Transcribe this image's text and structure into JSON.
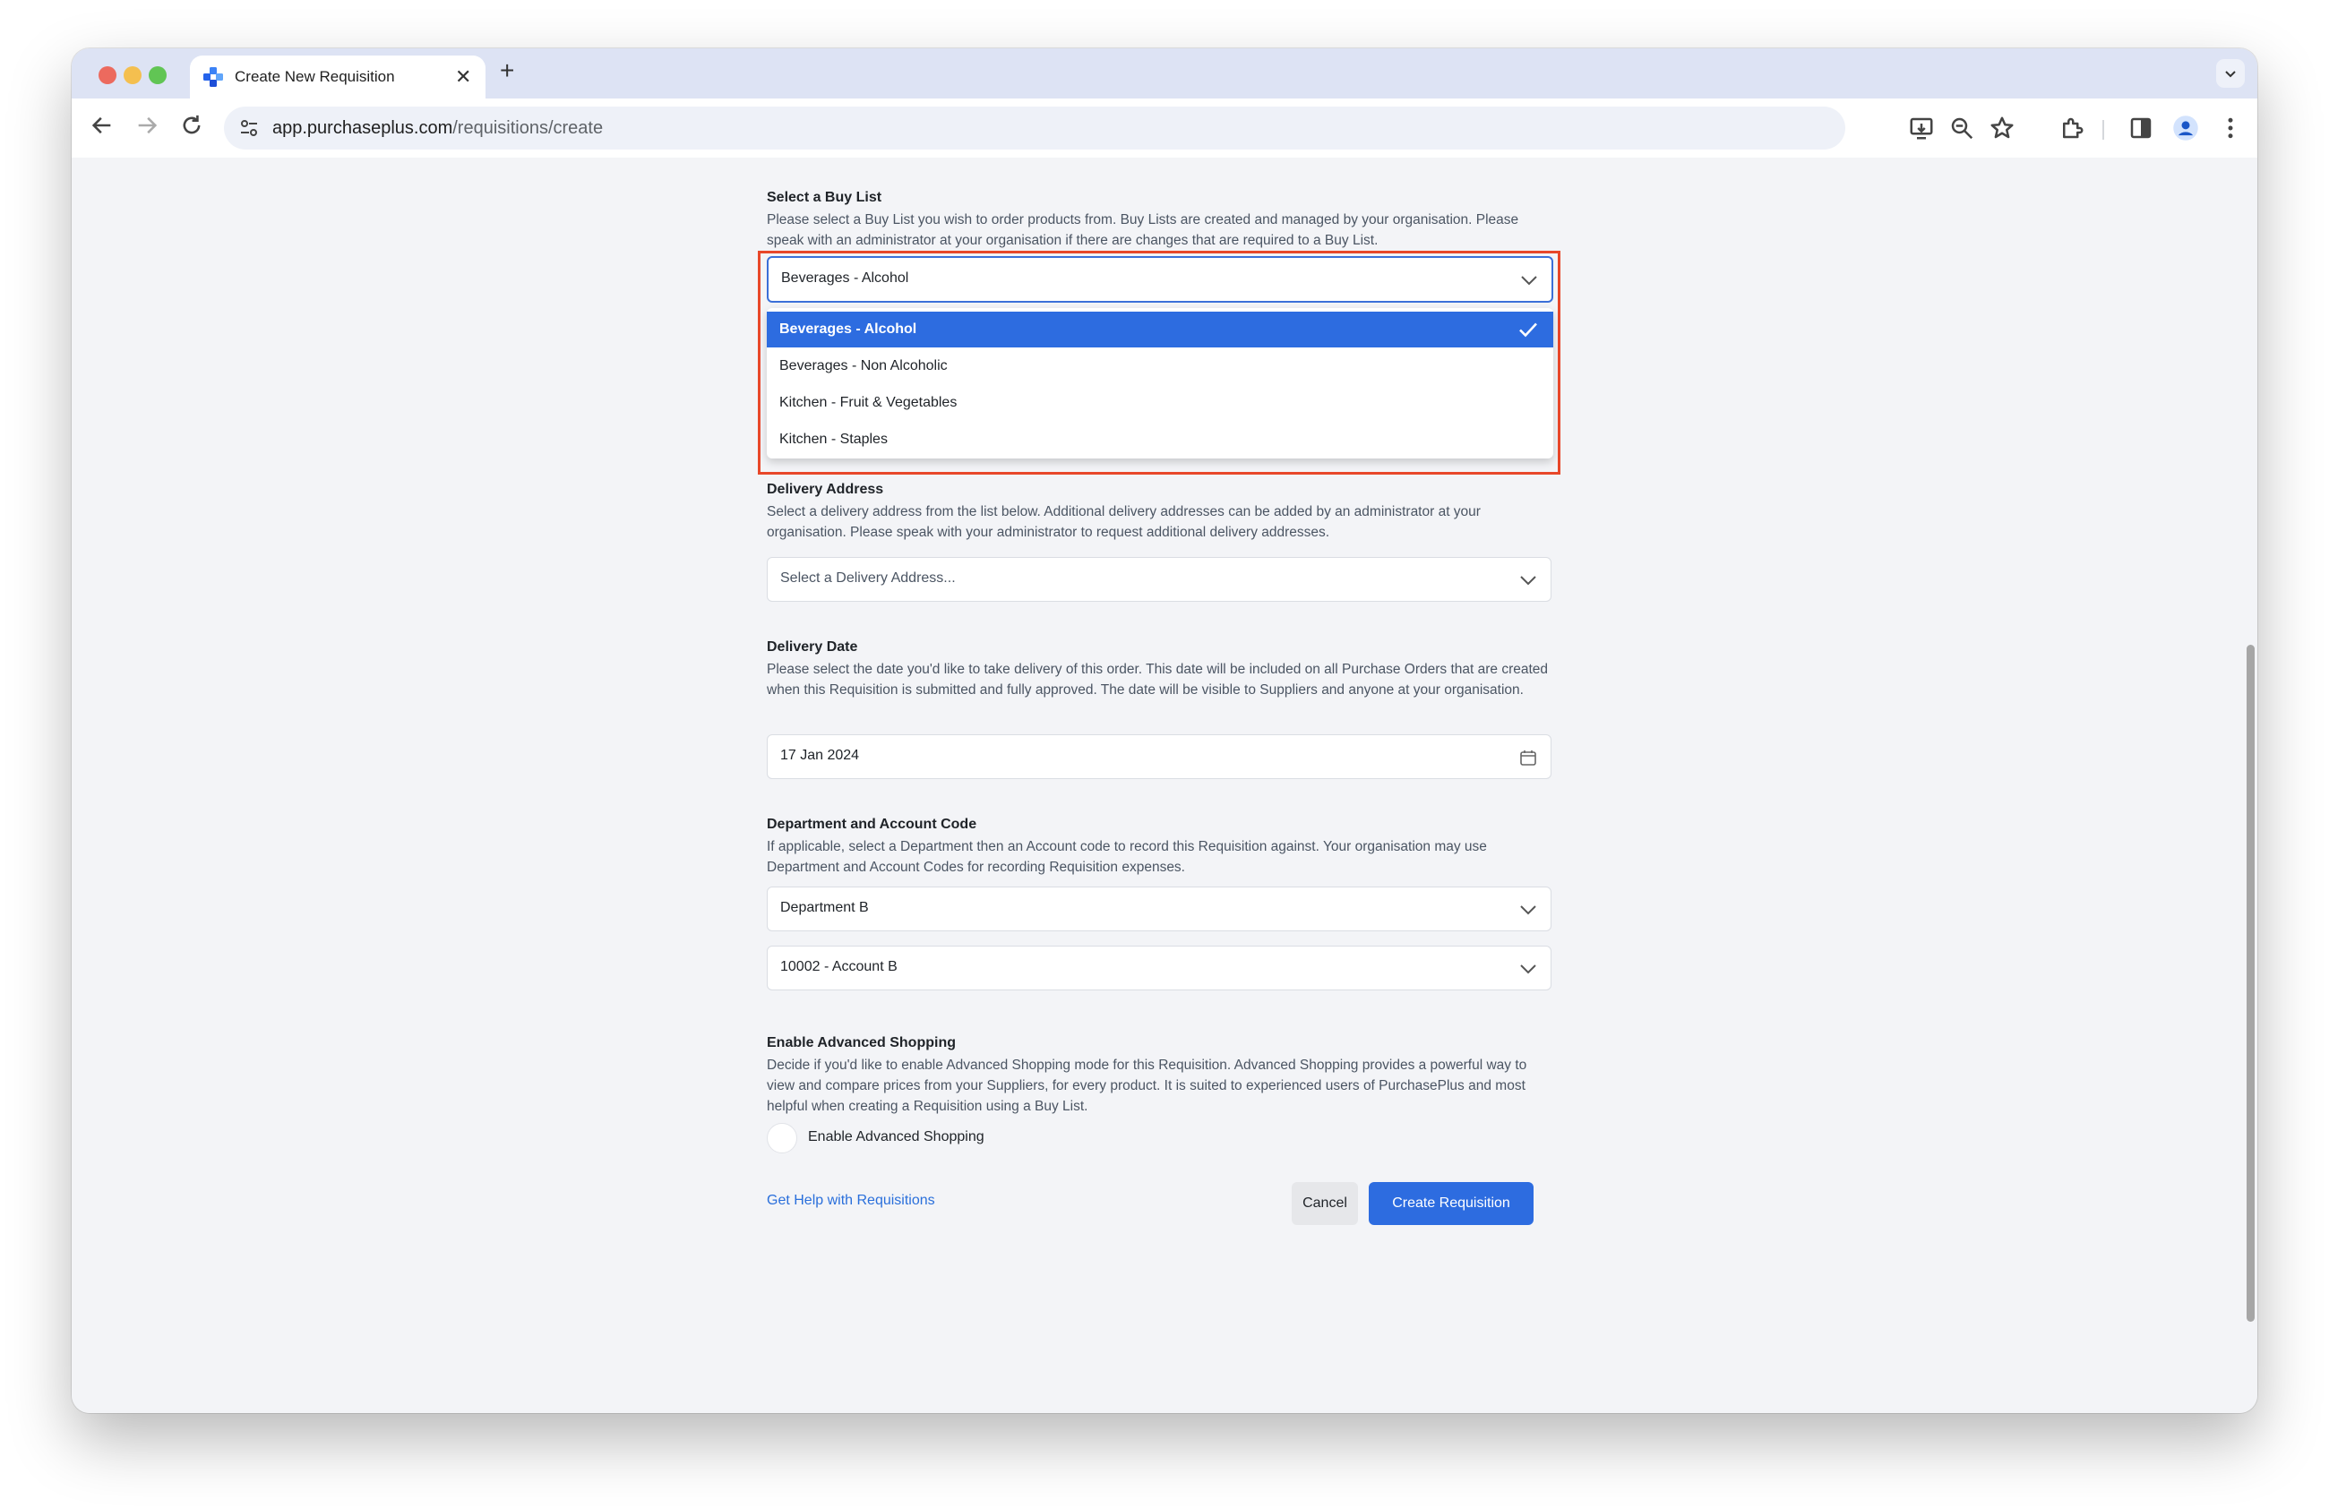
{
  "browser": {
    "tab_title": "Create New Requisition",
    "tab_close": "✕",
    "new_tab": "+",
    "url_domain": "app.purchaseplus.com",
    "url_path": "/requisitions/create"
  },
  "form": {
    "buy_list": {
      "title": "Select a Buy List",
      "description": "Please select a Buy List you wish to order products from. Buy Lists are created and managed by your organisation. Please speak with an administrator at your organisation if there are changes that are required to a Buy List.",
      "selected": "Beverages - Alcohol",
      "options": [
        "Beverages - Alcohol",
        "Beverages - Non Alcoholic",
        "Kitchen - Fruit & Vegetables",
        "Kitchen - Staples"
      ]
    },
    "delivery_address": {
      "title": "Delivery Address",
      "description": "Select a delivery address from the list below. Additional delivery addresses can be added by an administrator at your organisation. Please speak with your administrator to request additional delivery addresses.",
      "placeholder": "Select a Delivery Address..."
    },
    "delivery_date": {
      "title": "Delivery Date",
      "description": "Please select the date you'd like to take delivery of this order. This date will be included on all Purchase Orders that are created when this Requisition is submitted and fully approved. The date will be visible to Suppliers and anyone at your organisation.",
      "value": "17 Jan 2024"
    },
    "department": {
      "title": "Department and Account Code",
      "description": "If applicable, select a Department then an Account code to record this Requisition against. Your organisation may use Department and Account Codes for recording Requisition expenses.",
      "department_value": "Department B",
      "account_value": "10002 - Account B"
    },
    "advanced_shopping": {
      "title": "Enable Advanced Shopping",
      "description": "Decide if you'd like to enable Advanced Shopping mode for this Requisition. Advanced Shopping provides a powerful way to view and compare prices from your Suppliers, for every product. It is suited to experienced users of PurchasePlus and most helpful when creating a Requisition using a Buy List.",
      "toggle_label": "Enable Advanced Shopping"
    },
    "footer": {
      "help_link": "Get Help with Requisitions",
      "cancel_label": "Cancel",
      "create_label": "Create Requisition"
    }
  },
  "colors": {
    "accent": "#2d6ce0",
    "highlight_box": "#e8472a"
  }
}
